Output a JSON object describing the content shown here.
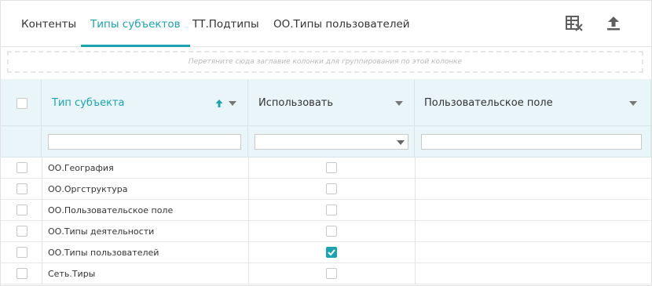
{
  "tabs": [
    {
      "label": "Контенты",
      "active": false
    },
    {
      "label": "Типы субъектов",
      "active": true
    },
    {
      "label": "ТТ.Подтипы",
      "active": false
    },
    {
      "label": "ОО.Типы пользователей",
      "active": false
    }
  ],
  "toolbar": {
    "export_excel_icon": "excel-clear-icon",
    "upload_icon": "upload-icon"
  },
  "group_panel": {
    "text": "Перетяните сюда заглавие колонки для группирования по этой колонке"
  },
  "columns": [
    {
      "label": "Тип субъекта",
      "sorted": "asc"
    },
    {
      "label": "Использовать"
    },
    {
      "label": "Пользовательское поле"
    }
  ],
  "filters": {
    "col1_value": "",
    "col2_value": "",
    "col3_value": ""
  },
  "rows": [
    {
      "type": "ОО.География",
      "use": false,
      "custom": ""
    },
    {
      "type": "ОО.Оргструктура",
      "use": false,
      "custom": ""
    },
    {
      "type": "ОО.Пользовательское поле",
      "use": false,
      "custom": ""
    },
    {
      "type": "ОО.Типы деятельности",
      "use": false,
      "custom": ""
    },
    {
      "type": "ОО.Типы пользователей",
      "use": true,
      "custom": ""
    },
    {
      "type": "Сеть.Тиры",
      "use": false,
      "custom": ""
    }
  ],
  "colors": {
    "accent": "#1aa3b0",
    "header_bg": "#eaf5f9"
  }
}
